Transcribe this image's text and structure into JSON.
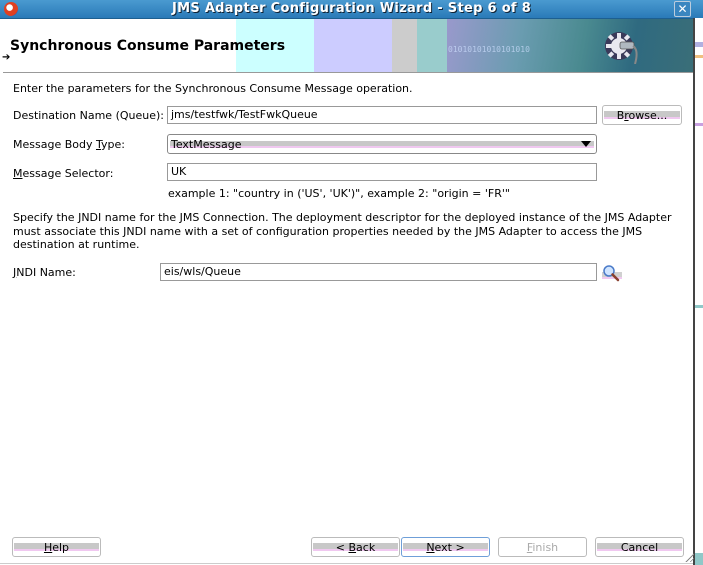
{
  "window": {
    "title": "JMS Adapter Configuration Wizard - Step 6 of 8",
    "close_label": "✕"
  },
  "header": {
    "page_title": "Synchronous Consume Parameters",
    "banner_bits": "01010101010101010"
  },
  "intro": "Enter the parameters for the Synchronous Consume Message operation.",
  "form": {
    "destination": {
      "label": "Destination Name (Queue):",
      "value": "jms/testfwk/TestFwkQueue",
      "browse_label_pre": "B",
      "browse_label_mnemonic": "r",
      "browse_label_post": "owse..."
    },
    "body_type": {
      "label_pre": "Message Body ",
      "label_mnemonic": "T",
      "label_post": "ype:",
      "selected": "TextMessage"
    },
    "selector": {
      "label_mnemonic": "M",
      "label_post": "essage Selector:",
      "value": "UK",
      "example": "example 1: \"country in ('US', 'UK')\", example 2: \"origin = 'FR'\""
    },
    "jndi_description": "Specify the JNDI name for the JMS Connection.  The deployment descriptor for the deployed instance of the JMS Adapter must associate this JNDI name with a set of configuration properties needed by the JMS Adapter to access the JMS destination at runtime.",
    "jndi": {
      "label_mnemonic": "J",
      "label_post": "NDI Name:",
      "value": "eis/wls/Queue"
    }
  },
  "footer": {
    "help_mnemonic": "H",
    "help_post": "elp",
    "back_pre": "< ",
    "back_mnemonic": "B",
    "back_post": "ack",
    "next_mnemonic": "N",
    "next_post": "ext >",
    "finish_mnemonic": "F",
    "finish_post": "inish",
    "cancel_label": "Cancel"
  }
}
